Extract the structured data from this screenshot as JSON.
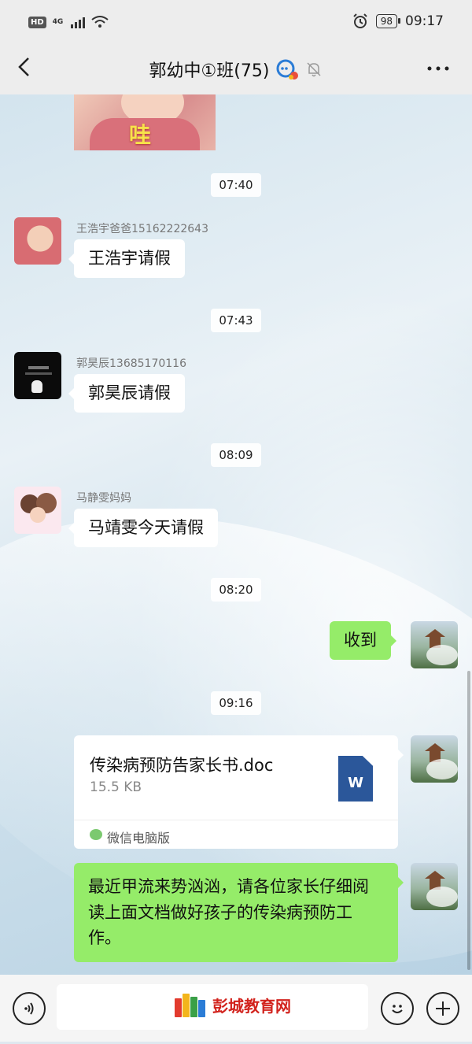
{
  "status_bar": {
    "hd": "HD",
    "network": "4G",
    "battery": "98",
    "time": "09:17"
  },
  "header": {
    "title": "郭幼中①班(75)",
    "back_icon": "chevron-left-icon",
    "more_icon": "more-dots-icon"
  },
  "messages": {
    "photo_text": "哇",
    "t1": "07:40",
    "m1": {
      "sender": "王浩宇爸爸15162222643",
      "text": "王浩宇请假"
    },
    "t2": "07:43",
    "m2": {
      "sender": "郭昊辰13685170116",
      "text": "郭昊辰请假"
    },
    "t3": "08:09",
    "m3": {
      "sender": "马静雯妈妈",
      "text": "马靖雯今天请假"
    },
    "t4": "08:20",
    "m4": {
      "text": "收到"
    },
    "t5": "09:16",
    "file": {
      "name": "传染病预防告家长书.doc",
      "size": "15.5 KB",
      "icon_letter": "W",
      "source": "微信电脑版"
    },
    "m5": {
      "text": "最近甲流来势汹汹，请各位家长仔细阅读上面文档做好孩子的传染病预防工作。"
    }
  },
  "input_bar": {
    "voice_icon": "voice-icon",
    "emoji_icon": "emoji-icon",
    "plus_icon": "plus-icon",
    "watermark": "彭城教育网"
  },
  "colors": {
    "green_bubble": "#95ec69",
    "header_bg": "#ededed",
    "watermark_red": "#d2231d"
  }
}
